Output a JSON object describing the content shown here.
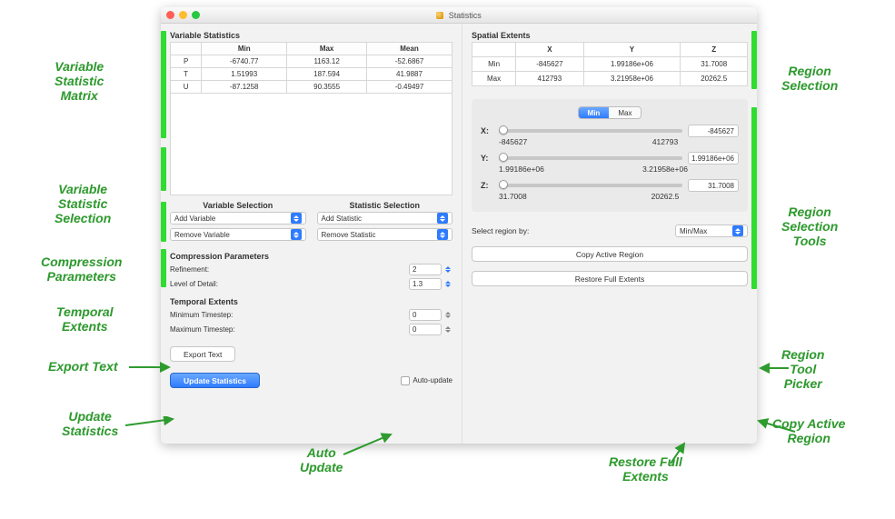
{
  "window": {
    "title": "Statistics"
  },
  "left": {
    "var_stats": {
      "heading": "Variable Statistics",
      "cols": [
        "",
        "Min",
        "Max",
        "Mean"
      ],
      "rows": [
        [
          "P",
          "-6740.77",
          "1163.12",
          "-52.6867"
        ],
        [
          "T",
          "1.51993",
          "187.594",
          "41.9887"
        ],
        [
          "U",
          "-87.1258",
          "90.3555",
          "-0.49497"
        ]
      ]
    },
    "var_sel": {
      "heading": "Variable Selection",
      "add": "Add Variable",
      "remove": "Remove Variable"
    },
    "stat_sel": {
      "heading": "Statistic Selection",
      "add": "Add Statistic",
      "remove": "Remove Statistic"
    },
    "comp": {
      "heading": "Compression Parameters",
      "ref_label": "Refinement:",
      "ref_val": "2",
      "lod_label": "Level of Detail:",
      "lod_val": "1.3"
    },
    "temporal": {
      "heading": "Temporal Extents",
      "min_label": "Minimum Timestep:",
      "min_val": "0",
      "max_label": "Maximum Timestep:",
      "max_val": "0"
    },
    "export_label": "Export Text",
    "update_label": "Update Statistics",
    "auto_label": "Auto-update"
  },
  "right": {
    "spatial": {
      "heading": "Spatial Extents",
      "cols": [
        "",
        "X",
        "Y",
        "Z"
      ],
      "rows": [
        [
          "Min",
          "-845627",
          "1.99186e+06",
          "31.7008"
        ],
        [
          "Max",
          "412793",
          "3.21958e+06",
          "20262.5"
        ]
      ]
    },
    "seg": {
      "min": "Min",
      "max": "Max"
    },
    "sliders": {
      "x": {
        "label": "X:",
        "val": "-845627",
        "low": "-845627",
        "high": "412793"
      },
      "y": {
        "label": "Y:",
        "val": "1.99186e+06",
        "low": "1.99186e+06",
        "high": "3.21958e+06"
      },
      "z": {
        "label": "Z:",
        "val": "31.7008",
        "low": "31.7008",
        "high": "20262.5"
      }
    },
    "region_by_label": "Select region by:",
    "region_by_value": "Min/Max",
    "copy_label": "Copy Active Region",
    "restore_label": "Restore Full Extents"
  },
  "annot": {
    "var_stat_matrix": "Variable\nStatistic\nMatrix",
    "var_stat_sel": "Variable\nStatistic\nSelection",
    "comp_params": "Compression\nParameters",
    "temporal_ext": "Temporal\nExtents",
    "export_text": "Export Text",
    "update_stats": "Update\nStatistics",
    "auto_update": "Auto\nUpdate",
    "region_sel": "Region\nSelection",
    "region_sel_tools": "Region\nSelection\nTools",
    "region_tool_picker": "Region\nTool\nPicker",
    "copy_active": "Copy Active\nRegion",
    "restore_full": "Restore Full\nExtents"
  }
}
